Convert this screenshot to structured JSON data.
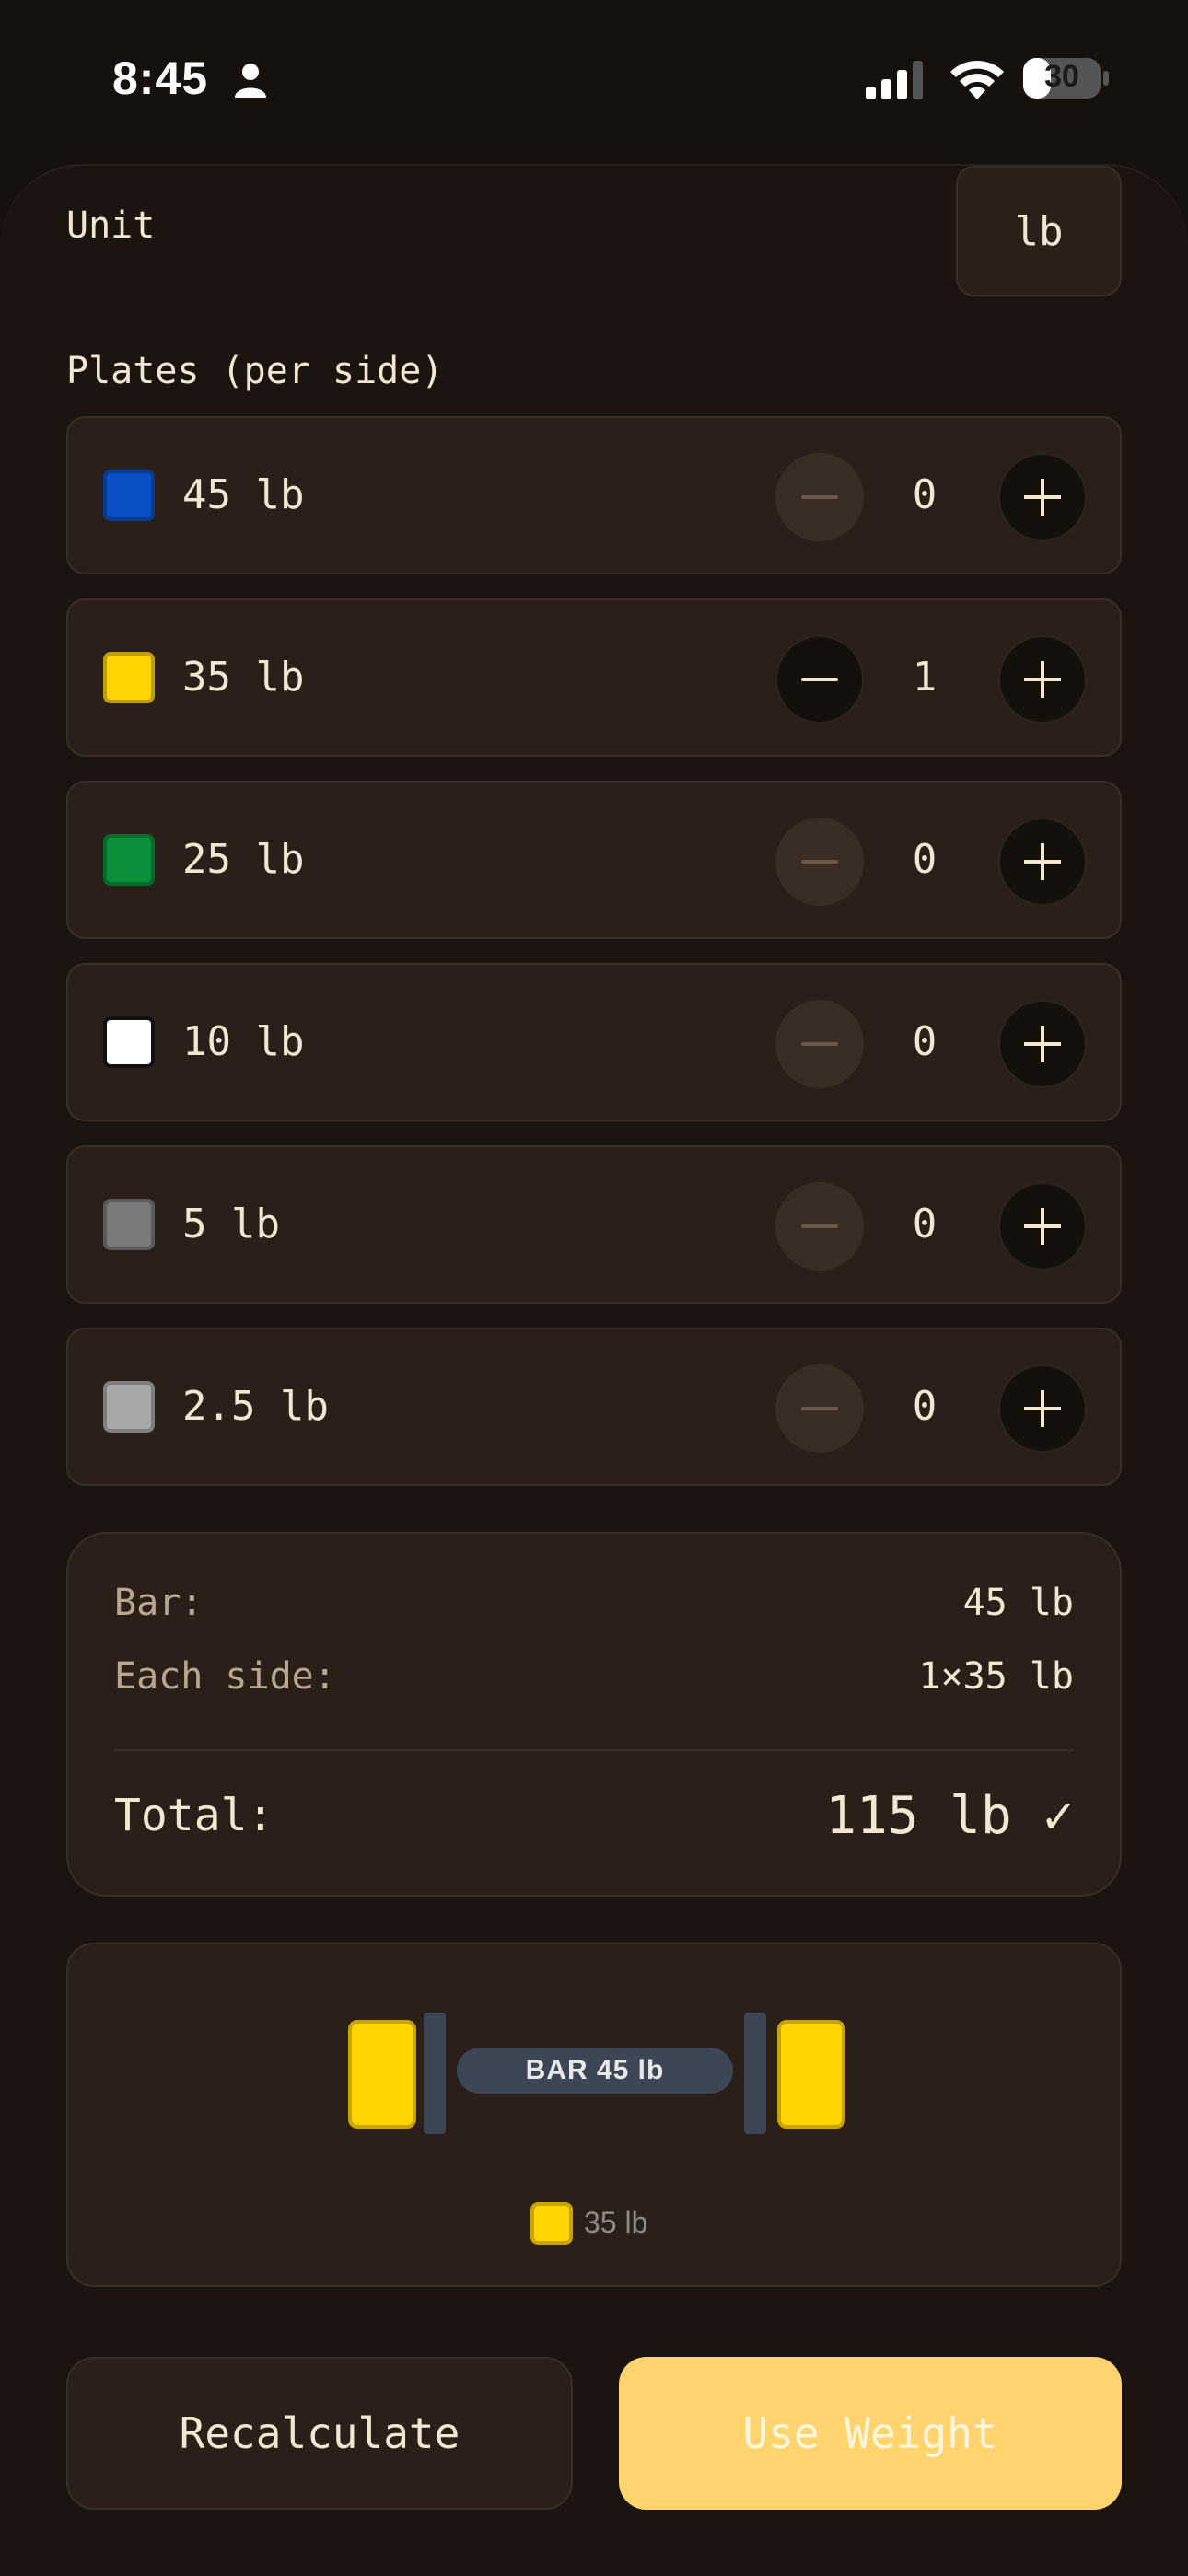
{
  "status_bar": {
    "time": "8:45",
    "battery": "30"
  },
  "unit": {
    "label": "Unit",
    "value": "lb"
  },
  "plates_label": "Plates (per side)",
  "plates": [
    {
      "name": "45 lb",
      "count": "0",
      "color": "#0a4fc4"
    },
    {
      "name": "35 lb",
      "count": "1",
      "color": "#ffd400"
    },
    {
      "name": "25 lb",
      "count": "0",
      "color": "#0a8f3a"
    },
    {
      "name": "10 lb",
      "count": "0",
      "color": "#ffffff"
    },
    {
      "name": "5 lb",
      "count": "0",
      "color": "#7a7a7a"
    },
    {
      "name": "2.5 lb",
      "count": "0",
      "color": "#a8a8a8"
    }
  ],
  "summary": {
    "bar_label": "Bar:",
    "bar_value": "45 lb",
    "side_label": "Each side:",
    "side_value": "1×35 lb",
    "total_label": "Total:",
    "total_value": "115 lb ✓"
  },
  "visual": {
    "bar_text": "BAR 45 lb",
    "plate_color": "#ffd400",
    "legend_text": "35 lb"
  },
  "buttons": {
    "recalculate": "Recalculate",
    "use_weight": "Use Weight"
  }
}
